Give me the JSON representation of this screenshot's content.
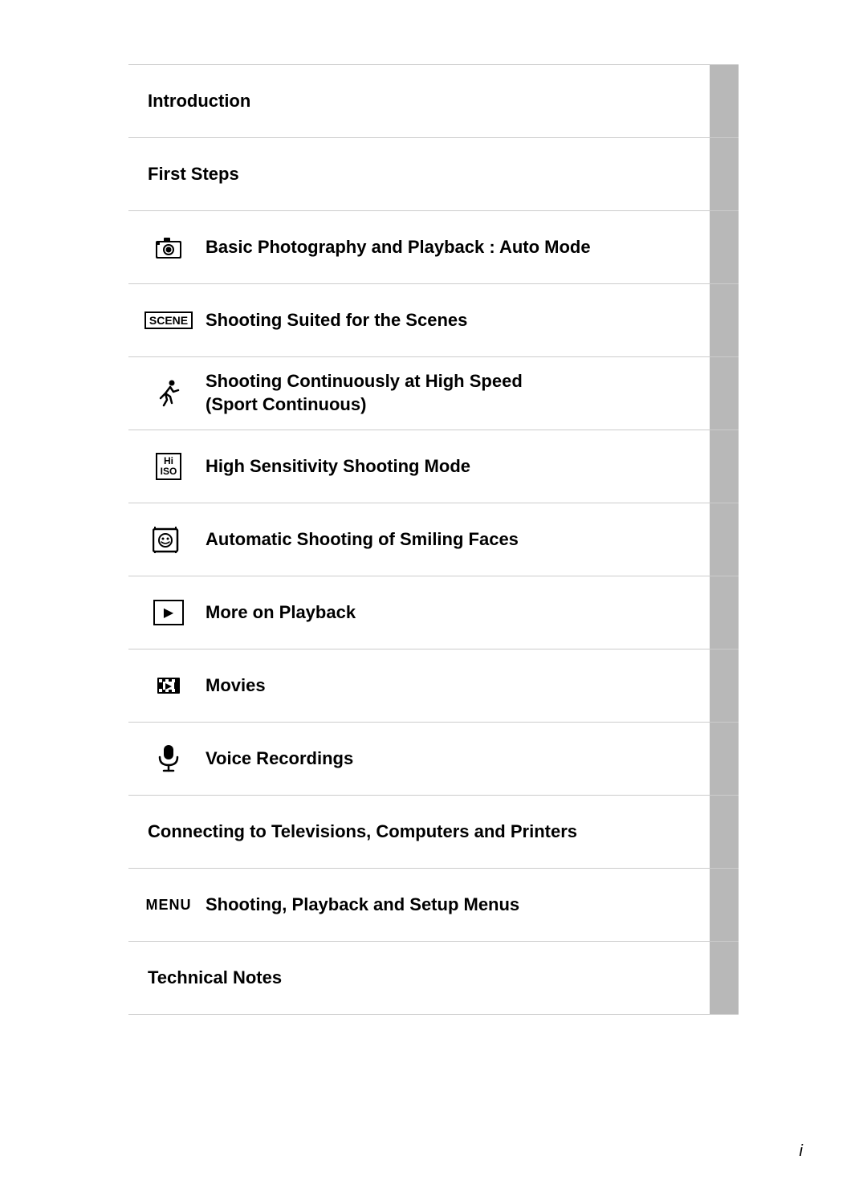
{
  "toc": {
    "rows": [
      {
        "id": "introduction",
        "label": "Introduction",
        "icon": null,
        "iconType": null
      },
      {
        "id": "first-steps",
        "label": "First Steps",
        "icon": null,
        "iconType": null
      },
      {
        "id": "basic-photography",
        "label": "Basic Photography and Playback : Auto Mode",
        "icon": "📷",
        "iconType": "camera"
      },
      {
        "id": "shooting-scenes",
        "label": "Shooting Suited for the Scenes",
        "icon": "SCENE",
        "iconType": "scene"
      },
      {
        "id": "sport-continuous",
        "label": "Shooting Continuously at High Speed\n(Sport Continuous)",
        "icon": "🏃",
        "iconType": "sport"
      },
      {
        "id": "high-sensitivity",
        "label": "High Sensitivity Shooting Mode",
        "icon": "Hi ISO",
        "iconType": "hi-iso"
      },
      {
        "id": "smiling-faces",
        "label": "Automatic Shooting of Smiling Faces",
        "icon": "smile",
        "iconType": "smile"
      },
      {
        "id": "more-playback",
        "label": "More on Playback",
        "icon": "▶",
        "iconType": "playback"
      },
      {
        "id": "movies",
        "label": "Movies",
        "icon": "🎬",
        "iconType": "movies"
      },
      {
        "id": "voice-recordings",
        "label": "Voice Recordings",
        "icon": "🎤",
        "iconType": "mic"
      },
      {
        "id": "connecting",
        "label": "Connecting to Televisions, Computers and Printers",
        "icon": null,
        "iconType": null
      },
      {
        "id": "menus",
        "label": "Shooting, Playback and Setup Menus",
        "icon": "MENU",
        "iconType": "menu"
      },
      {
        "id": "technical-notes",
        "label": "Technical Notes",
        "icon": null,
        "iconType": null
      }
    ]
  },
  "page": {
    "number": "i"
  }
}
